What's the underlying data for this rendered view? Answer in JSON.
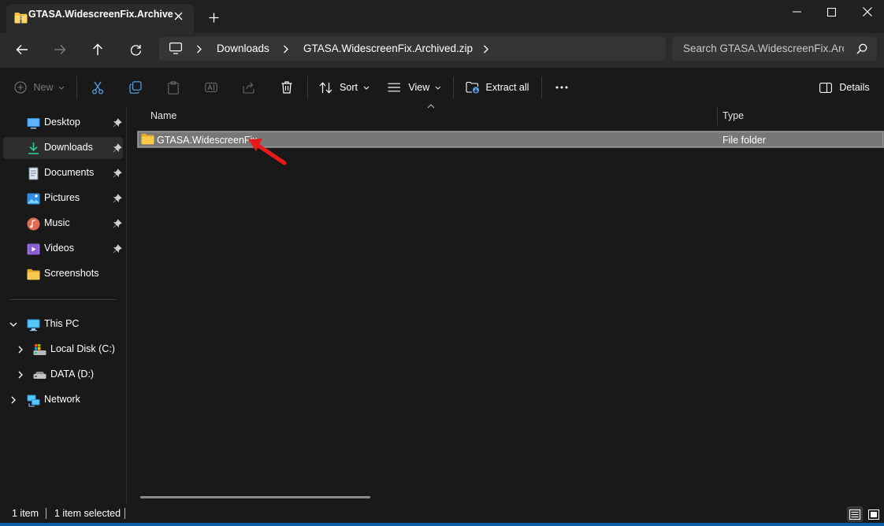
{
  "window": {
    "tab_title": "GTASA.WidescreenFix.Archive",
    "minimize_icon": "minimize-icon",
    "maximize_icon": "maximize-icon",
    "close_icon": "close-icon"
  },
  "address": {
    "breadcrumbs": [
      "Downloads",
      "GTASA.WidescreenFix.Archived.zip"
    ],
    "search_placeholder": "Search GTASA.WidescreenFix.Archived.zip"
  },
  "toolbar": {
    "new_label": "New",
    "sort_label": "Sort",
    "view_label": "View",
    "extract_label": "Extract all",
    "details_label": "Details"
  },
  "sidebar": {
    "quick_access": [
      {
        "label": "Desktop",
        "icon": "desktop-icon",
        "pinned": true
      },
      {
        "label": "Downloads",
        "icon": "download-icon",
        "pinned": true,
        "selected": true
      },
      {
        "label": "Documents",
        "icon": "document-icon",
        "pinned": true
      },
      {
        "label": "Pictures",
        "icon": "pictures-icon",
        "pinned": true
      },
      {
        "label": "Music",
        "icon": "music-icon",
        "pinned": true
      },
      {
        "label": "Videos",
        "icon": "video-icon",
        "pinned": true
      },
      {
        "label": "Screenshots",
        "icon": "folder-icon",
        "pinned": false
      }
    ],
    "this_pc": {
      "label": "This PC",
      "expanded": true
    },
    "drives": [
      {
        "label": "Local Disk (C:)",
        "icon": "drive-c-icon"
      },
      {
        "label": "DATA (D:)",
        "icon": "drive-d-icon"
      }
    ],
    "network": {
      "label": "Network"
    }
  },
  "file_list": {
    "columns": [
      "Name",
      "Type"
    ],
    "rows": [
      {
        "name": "GTASA.WidescreenFix",
        "type": "File folder",
        "selected": true,
        "icon": "folder-icon"
      }
    ]
  },
  "status": {
    "item_count": "1 item",
    "selected_count": "1 item selected"
  },
  "colors": {
    "background": "#191919",
    "titlebar": "#202020",
    "selection": "#777777",
    "folder": "#f6c445",
    "annotation_arrow": "#e8191b",
    "accent": "#0b5fa8"
  }
}
